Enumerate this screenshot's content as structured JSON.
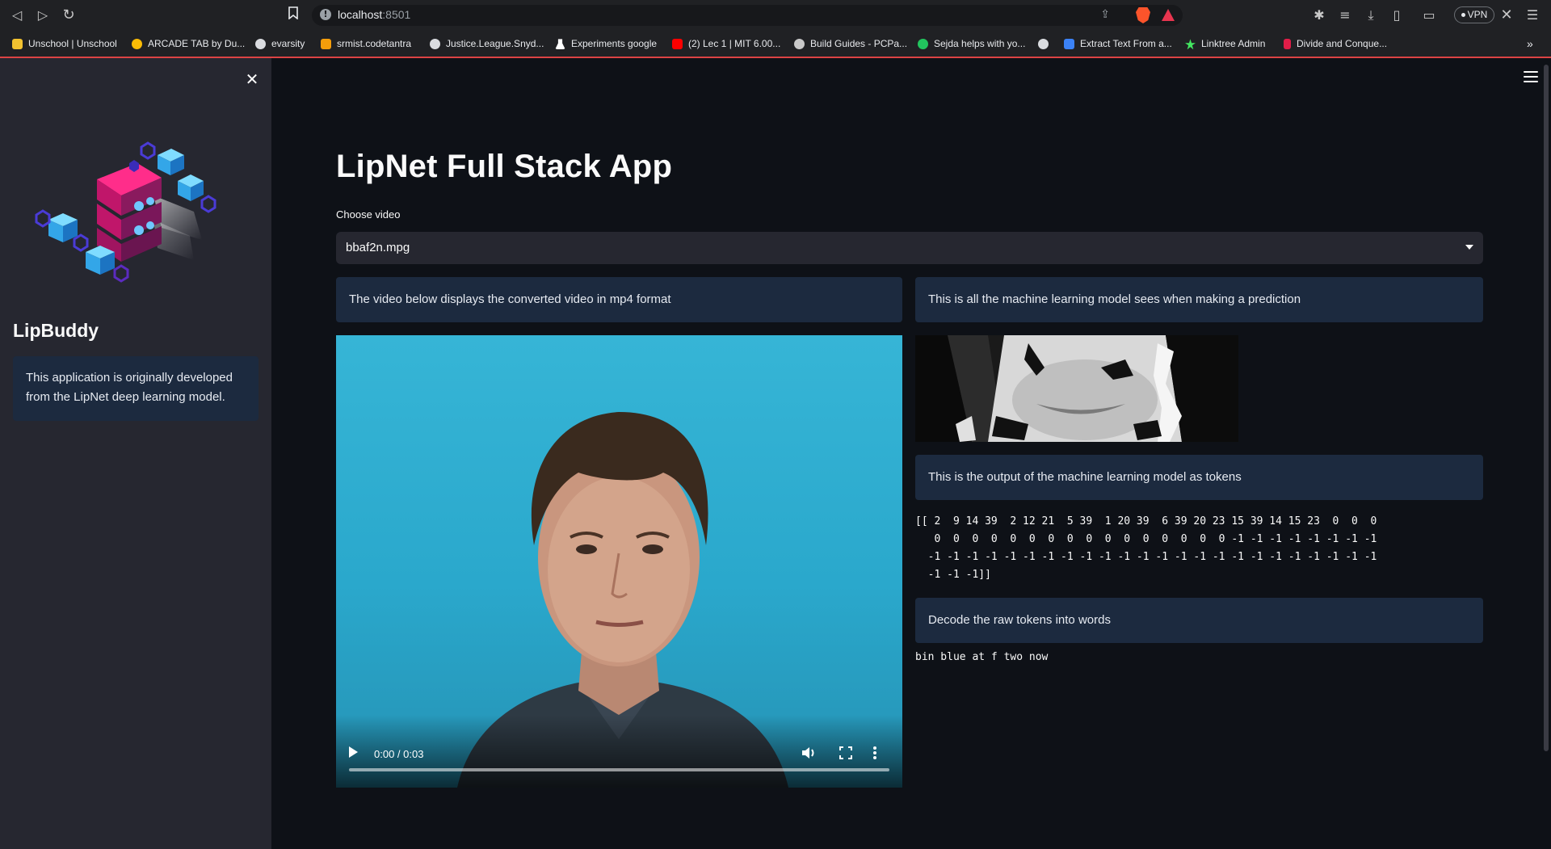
{
  "browser": {
    "url_host": "localhost",
    "url_port": ":8501",
    "vpn_label": "VPN",
    "bookmarks": [
      {
        "label": "Unschool | Unschool",
        "icon": "unschool-icon",
        "color": "#f2c230"
      },
      {
        "label": "ARCADE TAB by Du...",
        "icon": "google-icon",
        "color": "#fbbc05"
      },
      {
        "label": "evarsity",
        "icon": "globe-icon",
        "color": "#dadce0"
      },
      {
        "label": "srmist.codetantra",
        "icon": "codetantra-icon",
        "color": "#f59e0b"
      },
      {
        "label": "Justice.League.Snyd...",
        "icon": "globe-icon",
        "color": "#dadce0"
      },
      {
        "label": "Experiments google",
        "icon": "flask-icon",
        "color": "#ffffff"
      },
      {
        "label": "(2) Lec 1 | MIT 6.00...",
        "icon": "youtube-icon",
        "color": "#ff0000"
      },
      {
        "label": "Build Guides - PCPa...",
        "icon": "pcpartpicker-icon",
        "color": "#c9c9c9"
      },
      {
        "label": "Sejda helps with yo...",
        "icon": "sejda-icon",
        "color": "#22c55e"
      },
      {
        "label": "",
        "icon": "globe-icon",
        "color": "#dadce0"
      },
      {
        "label": "Extract Text From a...",
        "icon": "extract-icon",
        "color": "#3b82f6"
      },
      {
        "label": "Linktree Admin",
        "icon": "linktree-icon",
        "color": "#43e660"
      },
      {
        "label": "Divide and Conque...",
        "icon": "bookmark-red-icon",
        "color": "#e11d48"
      }
    ]
  },
  "sidebar": {
    "title": "LipBuddy",
    "info": "This application is originally developed from the LipNet deep learning model."
  },
  "main": {
    "title": "LipNet Full Stack App",
    "select_label": "Choose video",
    "select_value": "bbaf2n.mpg",
    "left_info": "The video below displays the converted video in mp4 format",
    "right_info_1": "This is all the machine learning model sees when making a prediction",
    "right_info_2": "This is the output of the machine learning model as tokens",
    "right_info_3": "Decode the raw tokens into words",
    "tokens": "[[ 2  9 14 39  2 12 21  5 39  1 20 39  6 39 20 23 15 39 14 15 23  0  0  0\n   0  0  0  0  0  0  0  0  0  0  0  0  0  0  0  0 -1 -1 -1 -1 -1 -1 -1 -1\n  -1 -1 -1 -1 -1 -1 -1 -1 -1 -1 -1 -1 -1 -1 -1 -1 -1 -1 -1 -1 -1 -1 -1 -1\n  -1 -1 -1]]",
    "decoded": "bin blue at f two now"
  },
  "video": {
    "time": "0:00 / 0:03",
    "progress": 0
  }
}
